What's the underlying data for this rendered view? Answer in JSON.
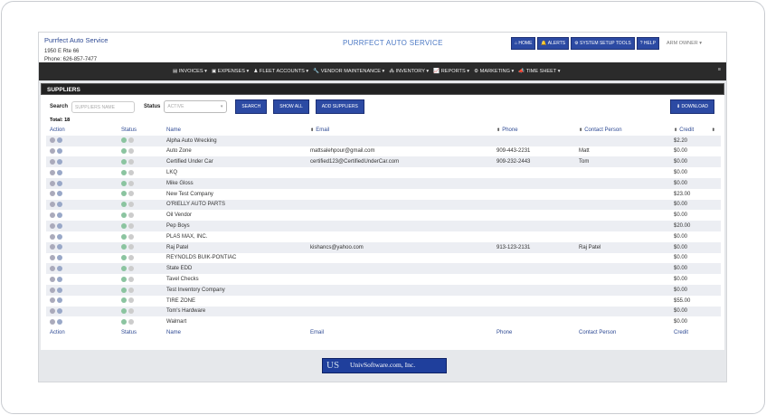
{
  "header": {
    "company": "Purrfect Auto Service",
    "address": "1950 E Rte 66",
    "phone": "Phone: 626-857-7477",
    "title": "PURRFECT AUTO SERVICE",
    "buttons": [
      "HOME",
      "ALERTS",
      "SYSTEM SETUP TOOLS",
      "HELP"
    ],
    "user": "ARM OWNER"
  },
  "nav": [
    "INVOICES",
    "EXPENSES",
    "FLEET ACCOUNTS",
    "VENDOR MAINTENANCE",
    "INVENTORY",
    "REPORTS",
    "MARKETING",
    "TIME SHEET"
  ],
  "panel": {
    "title": "SUPPLIERS",
    "search_label": "Search",
    "search_placeholder": "SUPPLIERS NAME",
    "status_label": "Status",
    "status_value": "ACTIVE",
    "search_btn": "SEARCH",
    "show_all": "SHOW ALL",
    "add": "ADD SUPPLIERS",
    "download": "DOWNLOAD",
    "total": "Total: 18"
  },
  "columns": [
    "Action",
    "Status",
    "Name",
    "Email",
    "Phone",
    "Contact Person",
    "Credit"
  ],
  "rows": [
    [
      "Alpha Auto Wrecking",
      "",
      "",
      "",
      "$2.20"
    ],
    [
      "Auto Zone",
      "mattsalehpour@gmail.com",
      "909-443-2231",
      "Matt",
      "$0.00"
    ],
    [
      "Certified Under Car",
      "certified123@CertifiedUnderCar.com",
      "909-232-2443",
      "Tom",
      "$0.00"
    ],
    [
      "LKQ",
      "",
      "",
      "",
      "$0.00"
    ],
    [
      "Mike Gloss",
      "",
      "",
      "",
      "$0.00"
    ],
    [
      "New Test Company",
      "",
      "",
      "",
      "$23.00"
    ],
    [
      "O'RIELLY AUTO PARTS",
      "",
      "",
      "",
      "$0.00"
    ],
    [
      "Oil Vendor",
      "",
      "",
      "",
      "$0.00"
    ],
    [
      "Pep Boys",
      "",
      "",
      "",
      "$20.00"
    ],
    [
      "PLAS MAX, INC.",
      "",
      "",
      "",
      "$0.00"
    ],
    [
      "Raj Patel",
      "kishancs@yahoo.com",
      "913-123-2131",
      "Raj Patel",
      "$0.00"
    ],
    [
      "REYNOLDS BUIK-PONTIAC",
      "",
      "",
      "",
      "$0.00"
    ],
    [
      "State EDD",
      "",
      "",
      "",
      "$0.00"
    ],
    [
      "Tavel Checks",
      "",
      "",
      "",
      "$0.00"
    ],
    [
      "Test Inventory Company",
      "",
      "",
      "",
      "$0.00"
    ],
    [
      "TIRE ZONE",
      "",
      "",
      "",
      "$55.00"
    ],
    [
      "Tom's Hardware",
      "",
      "",
      "",
      "$0.00"
    ],
    [
      "Walmart",
      "",
      "",
      "",
      "$0.00"
    ]
  ],
  "footer_logo": "UnivSoftware.com, Inc."
}
